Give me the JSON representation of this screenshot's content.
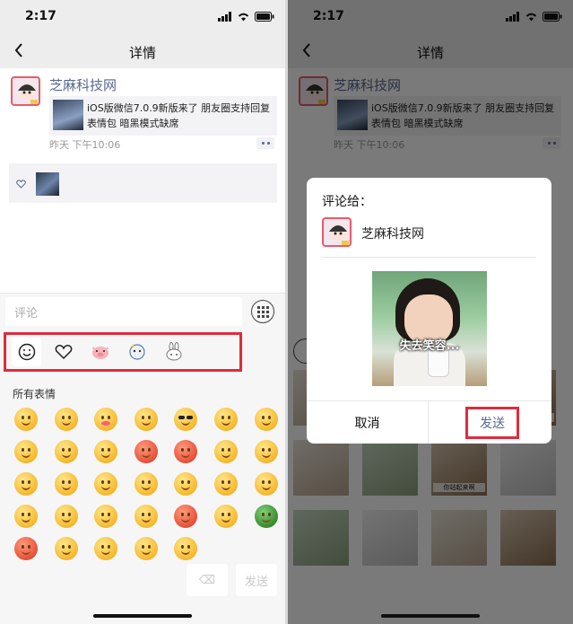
{
  "status": {
    "time": "2:17"
  },
  "nav": {
    "title": "详情"
  },
  "post": {
    "user_name": "芝麻科技网",
    "link_title": "iOS版微信7.0.9新版来了 朋友圈支持回复表情包 暗黑模式缺席",
    "time": "昨天 下午10:06"
  },
  "comment": {
    "placeholder": "评论"
  },
  "emoji_panel": {
    "categories": [
      "smiley-face",
      "heart",
      "pig",
      "cat-ghost",
      "bunny"
    ],
    "section_label": "所有表情",
    "emoji_count": 33,
    "delete_label": "⌫",
    "send_label": "发送"
  },
  "dialog": {
    "title": "评论给：",
    "recipient": "芝麻科技网",
    "sticker_caption": "失去笑容...",
    "cancel_label": "取消",
    "send_label": "发送"
  },
  "sticker_grid": {
    "captions": [
      "",
      "",
      "",
      "家境贫寒，告辞",
      "",
      "",
      "你站起来啊",
      "",
      "",
      "",
      "",
      ""
    ]
  },
  "colors": {
    "accent_blue": "#57688f",
    "highlight_red": "#e02b3c",
    "nav_gray": "#ededed"
  }
}
